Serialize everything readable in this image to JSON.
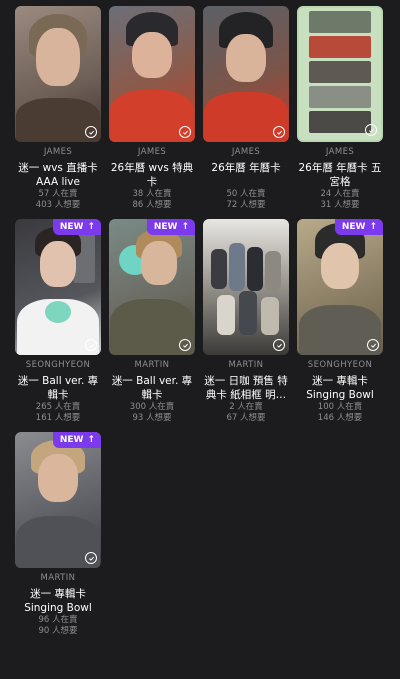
{
  "accent_color": "#7c3aed",
  "cards": [
    {
      "artist": "JAMES",
      "title": "迷一 wvs 直播卡 AAA live",
      "selling": "57 人在賣",
      "wanting": "403 人想要",
      "new": false
    },
    {
      "artist": "JAMES",
      "title": "26年曆 wvs 特典卡",
      "selling": "38 人在賣",
      "wanting": "86 人想要",
      "new": false
    },
    {
      "artist": "JAMES",
      "title": "26年曆 年曆卡",
      "selling": "50 人在賣",
      "wanting": "72 人想要",
      "new": false
    },
    {
      "artist": "JAMES",
      "title": "26年曆 年曆卡 五宮格",
      "selling": "24 人在賣",
      "wanting": "31 人想要",
      "new": false
    },
    {
      "artist": "SEONGHYEON",
      "title": "迷一 Ball ver. 專輯卡",
      "selling": "265 人在賣",
      "wanting": "161 人想要",
      "new": true
    },
    {
      "artist": "MARTIN",
      "title": "迷一 Ball ver. 專輯卡",
      "selling": "300 人在賣",
      "wanting": "93 人想要",
      "new": true
    },
    {
      "artist": "MARTIN",
      "title": "迷一 日咖 預售 特典卡 紙相框 明…",
      "selling": "2 人在賣",
      "wanting": "67 人想要",
      "new": false
    },
    {
      "artist": "SEONGHYEON",
      "title": "迷一 專輯卡 Singing Bowl v…",
      "selling": "100 人在賣",
      "wanting": "146 人想要",
      "new": true
    },
    {
      "artist": "MARTIN",
      "title": "迷一 專輯卡 Singing Bowl v…",
      "selling": "96 人在賣",
      "wanting": "90 人想要",
      "new": true
    }
  ],
  "badge_label": "NEW"
}
